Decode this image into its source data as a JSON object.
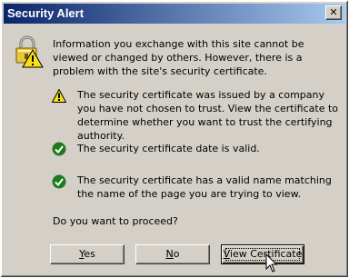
{
  "window": {
    "title": "Security Alert",
    "close_glyph": "✕"
  },
  "message": {
    "intro": "Information you exchange with this site cannot be viewed or changed by others. However, there is a problem with the site's security certificate.",
    "items": [
      {
        "icon": "warning-icon",
        "text": "The security certificate was issued by a company you have not chosen to trust. View the certificate to determine whether you want to trust the certifying authority."
      },
      {
        "icon": "check-icon",
        "text": "The security certificate date is valid."
      },
      {
        "icon": "check-icon",
        "text": "The security certificate has a valid name matching the name of the page you are trying to view."
      }
    ],
    "prompt": "Do you want to proceed?"
  },
  "buttons": {
    "yes_first": "Y",
    "yes_rest": "es",
    "no_first": "N",
    "no_rest": "o",
    "view_first": "V",
    "view_rest": "iew Certificate"
  },
  "colors": {
    "title_bar_start": "#0a246a",
    "title_bar_end": "#a6caf0",
    "dialog_bg": "#d4d0c8",
    "check_green": "#1e7a1e",
    "warning_yellow": "#f7e017"
  }
}
